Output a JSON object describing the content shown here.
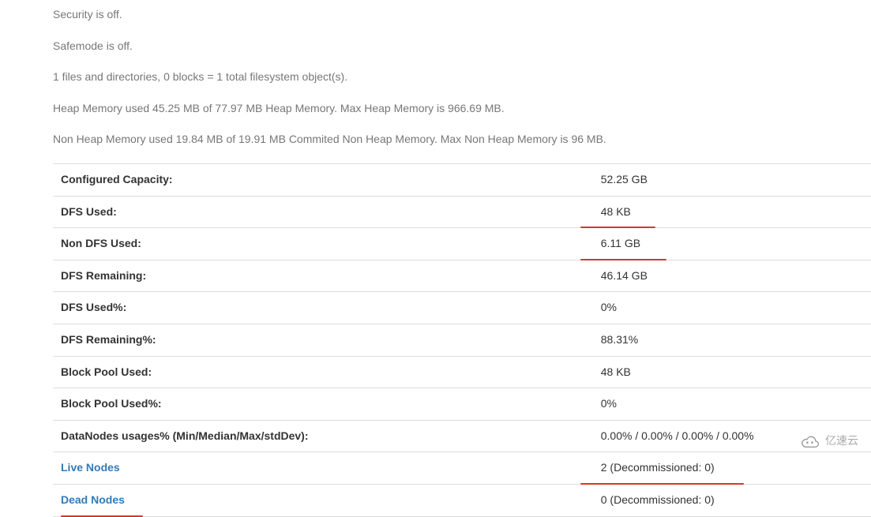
{
  "summary": {
    "security": "Security is off.",
    "safemode": "Safemode is off.",
    "files": "1 files and directories, 0 blocks = 1 total filesystem object(s).",
    "heap": "Heap Memory used 45.25 MB of 77.97 MB Heap Memory. Max Heap Memory is 966.69 MB.",
    "nonheap": "Non Heap Memory used 19.84 MB of 19.91 MB Commited Non Heap Memory. Max Non Heap Memory is 96 MB."
  },
  "rows": [
    {
      "label": "Configured Capacity:",
      "value": "52.25 GB",
      "link": false,
      "annot": false
    },
    {
      "label": "DFS Used:",
      "value": "48 KB",
      "link": false,
      "annot": "value"
    },
    {
      "label": "Non DFS Used:",
      "value": "6.11 GB",
      "link": false,
      "annot": "value"
    },
    {
      "label": "DFS Remaining:",
      "value": "46.14 GB",
      "link": false,
      "annot": false
    },
    {
      "label": "DFS Used%:",
      "value": "0%",
      "link": false,
      "annot": false
    },
    {
      "label": "DFS Remaining%:",
      "value": "88.31%",
      "link": false,
      "annot": false
    },
    {
      "label": "Block Pool Used:",
      "value": "48 KB",
      "link": false,
      "annot": false
    },
    {
      "label": "Block Pool Used%:",
      "value": "0%",
      "link": false,
      "annot": false
    },
    {
      "label": "DataNodes usages% (Min/Median/Max/stdDev):",
      "value": "0.00% / 0.00% / 0.00% / 0.00%",
      "link": false,
      "annot": false
    },
    {
      "label": "Live Nodes",
      "value": "2 (Decommissioned: 0)",
      "link": true,
      "annot": "value"
    },
    {
      "label": "Dead Nodes",
      "value": "0 (Decommissioned: 0)",
      "link": true,
      "annot": "label"
    }
  ],
  "watermark": "亿速云"
}
